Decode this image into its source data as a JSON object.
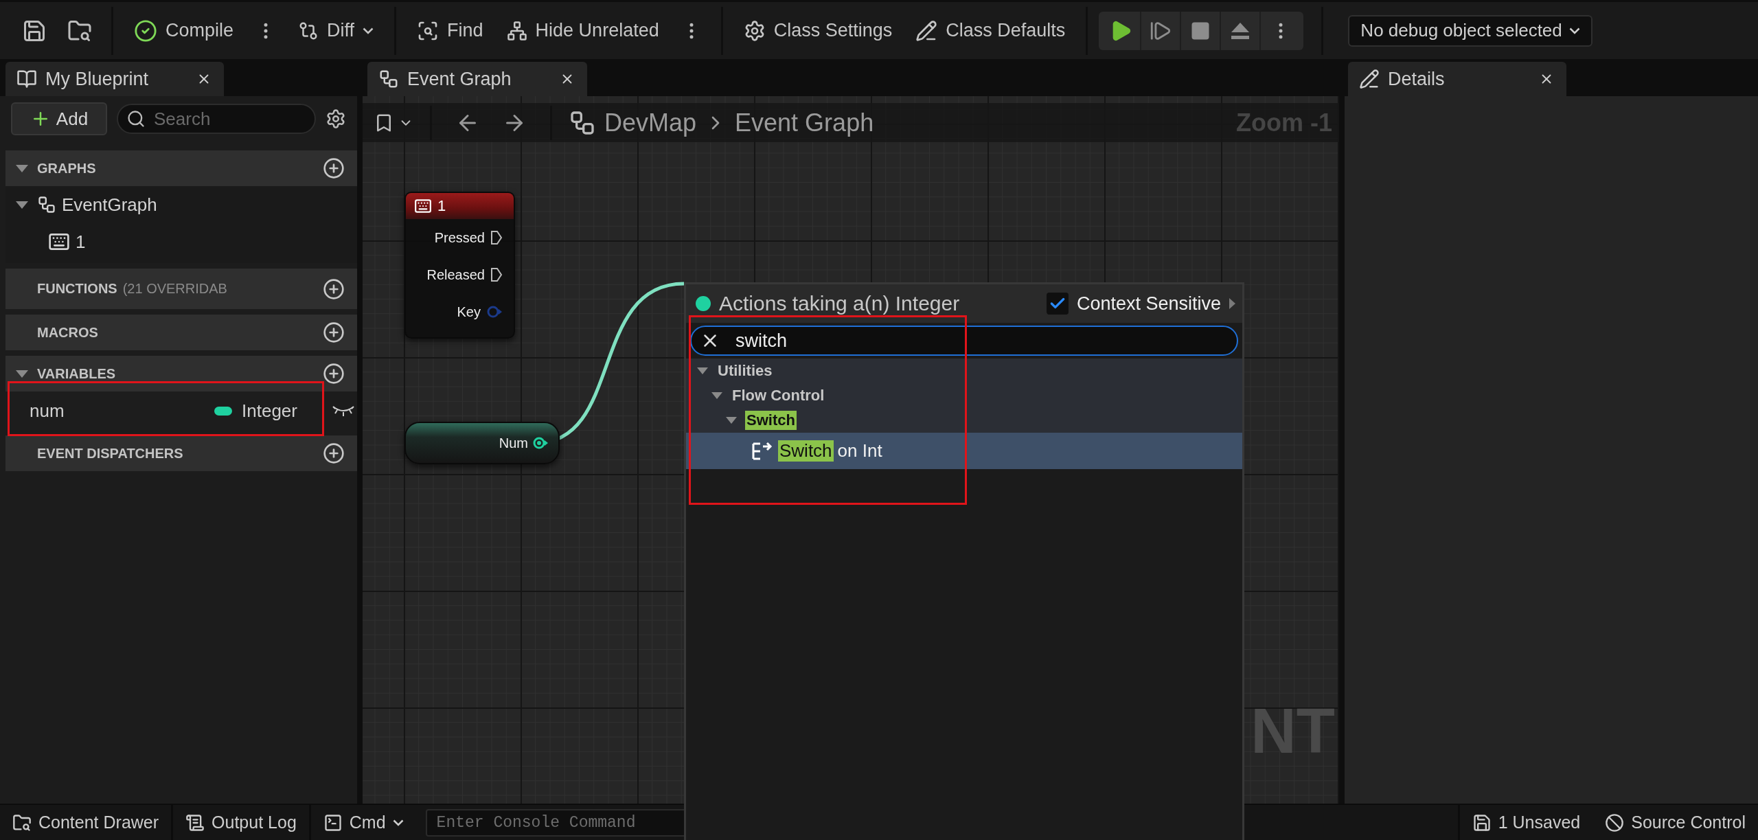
{
  "toolbar": {
    "buttons": [
      {
        "label": "Compile"
      },
      {
        "label": "Diff"
      },
      {
        "label": "Find"
      },
      {
        "label": "Hide Unrelated"
      },
      {
        "label": "Class Settings"
      },
      {
        "label": "Class Defaults"
      }
    ],
    "debug_filter": {
      "value": "No debug object selected"
    }
  },
  "left_panel": {
    "tab": {
      "label": "My Blueprint"
    },
    "add_button": "Add",
    "search": {
      "placeholder": "Search"
    },
    "sections": [
      {
        "title": "GRAPHS",
        "expanded": true,
        "items": [
          {
            "label": "EventGraph",
            "expanded": true,
            "children": [
              {
                "label": "1"
              }
            ]
          }
        ]
      },
      {
        "title": "FUNCTIONS",
        "expanded": false,
        "note": "(21 OVERRIDAB"
      },
      {
        "title": "MACROS",
        "expanded": false
      },
      {
        "title": "VARIABLES",
        "expanded": true,
        "variables": [
          {
            "name": "num",
            "type": "Integer",
            "color": "#1fd1a0"
          }
        ]
      },
      {
        "title": "EVENT DISPATCHERS",
        "expanded": false
      }
    ]
  },
  "graph": {
    "tab": {
      "label": "Event Graph"
    },
    "breadcrumb": [
      "DevMap",
      "Event Graph"
    ],
    "zoom": "Zoom -1",
    "watermark": "NT",
    "nodes": [
      {
        "kind": "event",
        "title": "1",
        "pins": [
          {
            "label": "Pressed",
            "kind": "exec"
          },
          {
            "label": "Released",
            "kind": "exec"
          },
          {
            "label": "Key",
            "kind": "data"
          }
        ]
      },
      {
        "kind": "variable",
        "pins": [
          {
            "label": "Num",
            "kind": "data"
          }
        ]
      }
    ]
  },
  "details_panel": {
    "tab": {
      "label": "Details"
    }
  },
  "action_menu": {
    "title": "Actions taking a(n) Integer",
    "context_sensitive": {
      "label": "Context Sensitive",
      "checked": true
    },
    "search": {
      "value": "switch"
    },
    "tree": [
      {
        "label": "Utilities",
        "expanded": true,
        "highlighted": false,
        "children": [
          {
            "label": "Flow Control",
            "expanded": true,
            "highlighted": false,
            "children": [
              {
                "label": "Switch",
                "expanded": true,
                "highlighted": true,
                "children": [
                  {
                    "match": "Switch",
                    "rest": "on Int",
                    "selected": true
                  }
                ]
              }
            ]
          }
        ]
      }
    ]
  },
  "status_bar": {
    "left": [
      {
        "label": "Content Drawer"
      },
      {
        "label": "Output Log"
      }
    ],
    "cmd": "Cmd",
    "console": {
      "placeholder": "Enter Console Command"
    },
    "right": [
      {
        "label": "1 Unsaved"
      },
      {
        "label": "Source Control"
      }
    ]
  }
}
